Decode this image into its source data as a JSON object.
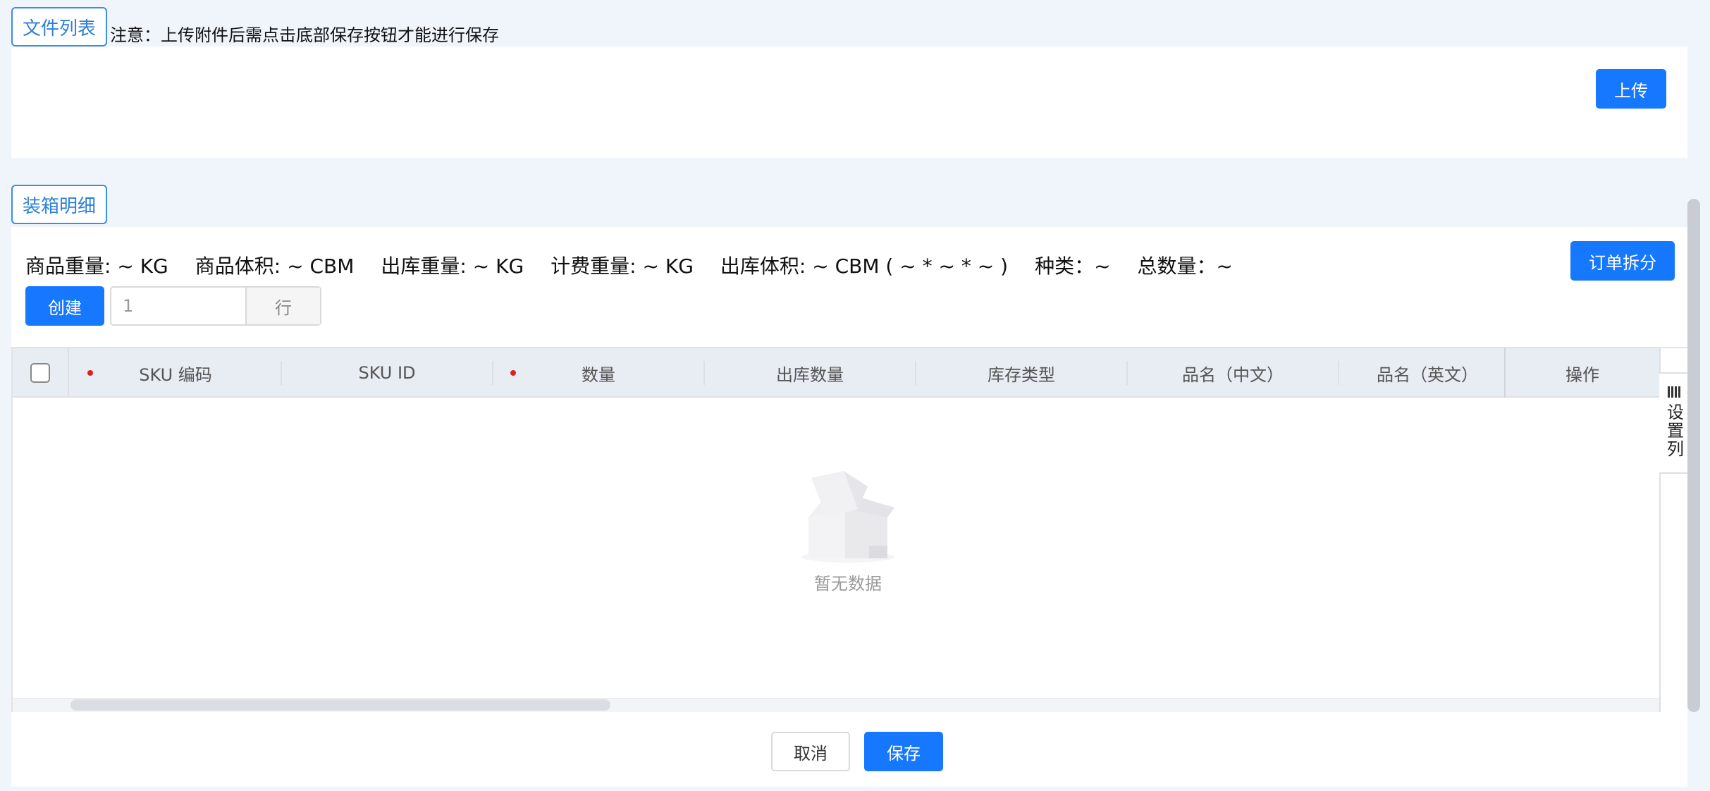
{
  "files": {
    "tag_label": "文件列表",
    "notice": "注意：上传附件后需点击底部保存按钮才能进行保存",
    "upload_label": "上传"
  },
  "packing": {
    "tag_label": "装箱明细",
    "summary": {
      "goods_weight": "商品重量: ~ KG",
      "goods_volume": "商品体积: ~ CBM",
      "out_weight": "出库重量: ~ KG",
      "charge_weight": "计费重量: ~ KG",
      "out_volume": "出库体积: ~ CBM ( ~ * ~ * ~ )",
      "kinds": "种类：~",
      "total_qty": "总数量：~"
    },
    "split_label": "订单拆分",
    "create_label": "创建",
    "rows_value": "1",
    "rows_unit": "行"
  },
  "table": {
    "columns": [
      "SKU 编码",
      "SKU ID",
      "数量",
      "出库数量",
      "库存类型",
      "品名（中文）",
      "品名（英文）",
      "操作"
    ],
    "required": [
      true,
      false,
      true,
      false,
      false,
      false,
      false,
      false
    ],
    "empty_text": "暂无数据",
    "settings_label": "设置列"
  },
  "footer": {
    "cancel_label": "取消",
    "save_label": "保存"
  },
  "colors": {
    "primary": "#1677ff",
    "page_bg": "#f0f5fc",
    "header_bg": "#e8ecf3",
    "required": "#e02020"
  },
  "icons": {
    "empty": "empty-box-icon",
    "settings": "columns-icon"
  }
}
